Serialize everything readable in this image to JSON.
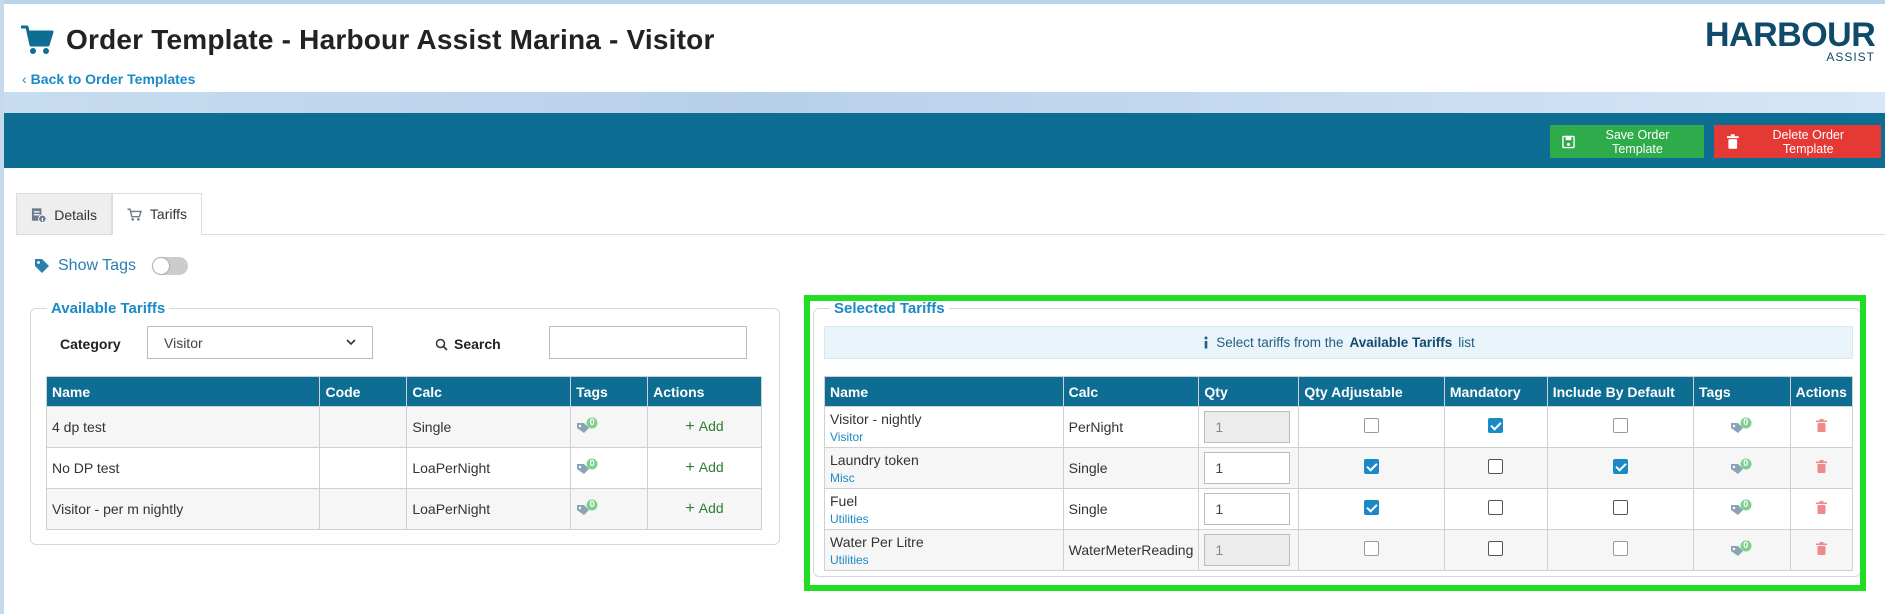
{
  "header": {
    "title": "Order Template - Harbour Assist Marina - Visitor",
    "back_link": "Back to Order Templates",
    "logo_main": "HARBOUR",
    "logo_sub": "ASSIST"
  },
  "toolbar": {
    "save_label": "Save Order Template",
    "delete_label": "Delete Order Template"
  },
  "tabs": [
    {
      "label": "Details"
    },
    {
      "label": "Tariffs"
    }
  ],
  "show_tags": {
    "label": "Show Tags",
    "enabled": false
  },
  "available": {
    "legend": "Available Tariffs",
    "category_label": "Category",
    "category_value": "Visitor",
    "search_label": "Search",
    "search_value": "",
    "columns": [
      "Name",
      "Code",
      "Calc",
      "Tags",
      "Actions"
    ],
    "rows": [
      {
        "name": "4 dp test",
        "code": "",
        "calc": "Single",
        "tags": "0",
        "action": "Add"
      },
      {
        "name": "No DP test",
        "code": "",
        "calc": "LoaPerNight",
        "tags": "0",
        "action": "Add"
      },
      {
        "name": "Visitor - per m nightly",
        "code": "",
        "calc": "LoaPerNight",
        "tags": "0",
        "action": "Add"
      }
    ]
  },
  "selected": {
    "legend": "Selected Tariffs",
    "info_prefix": "Select tariffs from the",
    "info_bold": "Available Tariffs",
    "info_suffix": "list",
    "columns": [
      "Name",
      "Calc",
      "Qty",
      "Qty Adjustable",
      "Mandatory",
      "Include By Default",
      "Tags",
      "Actions"
    ],
    "rows": [
      {
        "name": "Visitor - nightly",
        "category": "Visitor",
        "calc": "PerNight",
        "qty": "1",
        "qty_editable": false,
        "qty_adjustable": false,
        "mandatory": true,
        "include_default": false,
        "tags": "0"
      },
      {
        "name": "Laundry token",
        "category": "Misc",
        "calc": "Single",
        "qty": "1",
        "qty_editable": true,
        "qty_adjustable": true,
        "mandatory": false,
        "include_default": true,
        "tags": "0"
      },
      {
        "name": "Fuel",
        "category": "Utilities",
        "calc": "Single",
        "qty": "1",
        "qty_editable": true,
        "qty_adjustable": true,
        "mandatory": false,
        "include_default": false,
        "tags": "0"
      },
      {
        "name": "Water Per Litre",
        "category": "Utilities",
        "calc": "WaterMeterReading",
        "qty": "1",
        "qty_editable": false,
        "qty_adjustable": false,
        "mandatory": false,
        "include_default": false,
        "tags": "0"
      }
    ]
  },
  "colors": {
    "primary": "#0e6d92",
    "save": "#2eab4b",
    "delete": "#e53935",
    "link": "#1a8ac7",
    "highlight": "#22dd22"
  }
}
